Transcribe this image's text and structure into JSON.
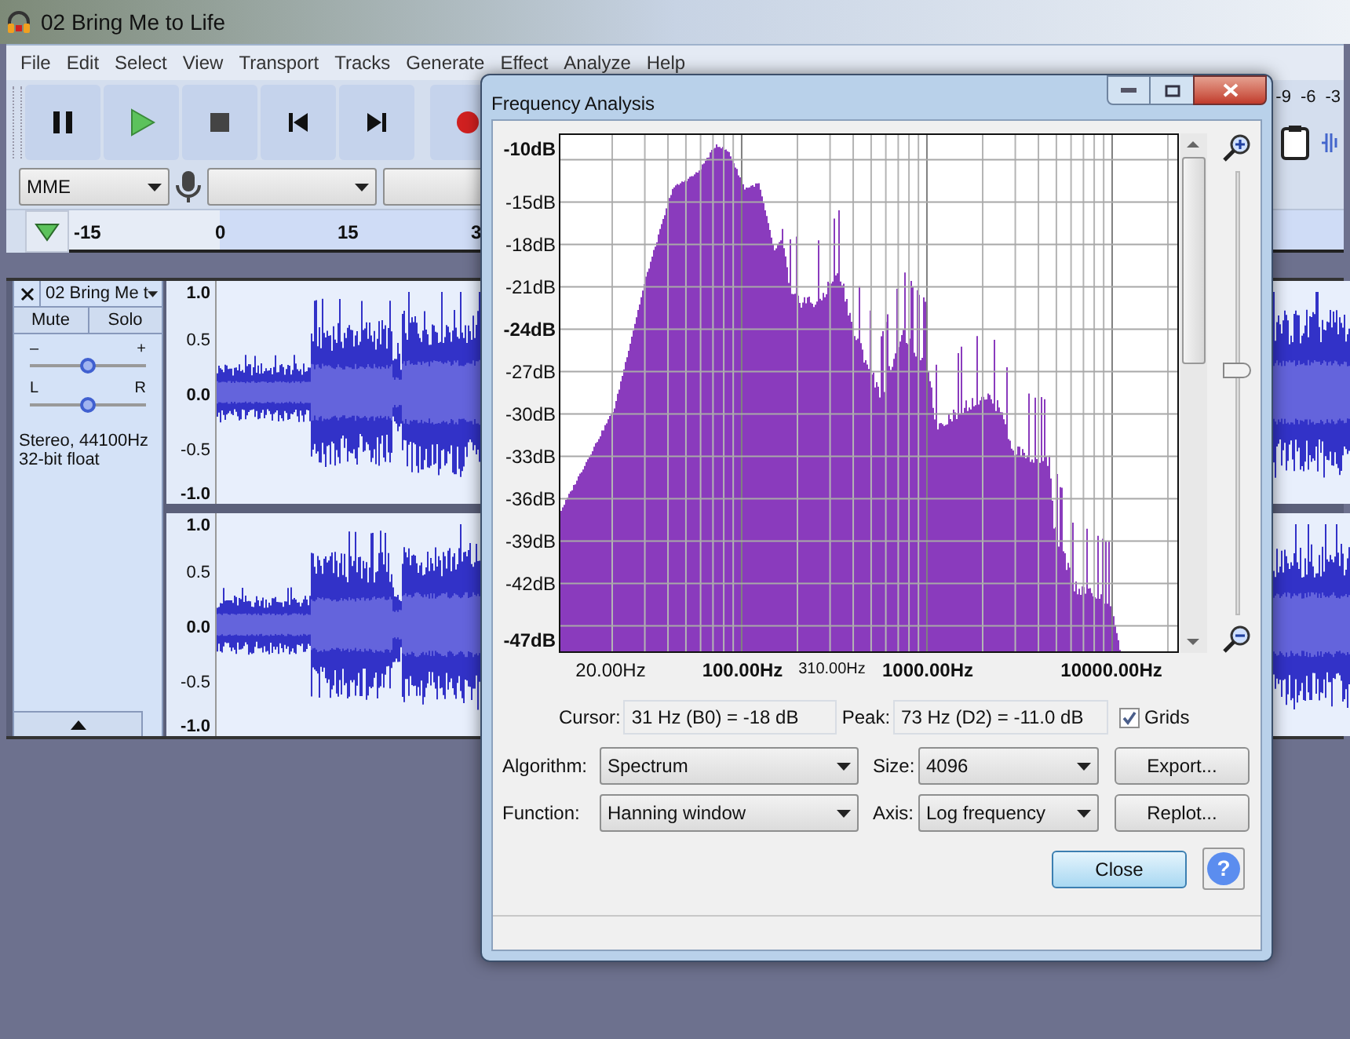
{
  "window": {
    "title": "02 Bring Me to Life"
  },
  "menu": [
    {
      "label": "File"
    },
    {
      "label": "Edit"
    },
    {
      "label": "Select"
    },
    {
      "label": "View"
    },
    {
      "label": "Transport"
    },
    {
      "label": "Tracks"
    },
    {
      "label": "Generate"
    },
    {
      "label": "Effect"
    },
    {
      "label": "Analyze"
    },
    {
      "label": "Help"
    }
  ],
  "meter": {
    "ticks": [
      "-9",
      "-6",
      "-3"
    ]
  },
  "device_bar": {
    "host": "MME"
  },
  "timeline": {
    "ticks": [
      "-15",
      "0",
      "15",
      "3"
    ]
  },
  "track": {
    "name": "02 Bring Me t",
    "mute": "Mute",
    "solo": "Solo",
    "gain": {
      "minus": "–",
      "plus": "+",
      "level": 0.5
    },
    "pan": {
      "left": "L",
      "right": "R",
      "level": 0.5
    },
    "info": [
      "Stereo, 44100Hz",
      "32-bit float"
    ],
    "channels": [
      {
        "scale": [
          "1.0",
          "0.5",
          "0.0",
          "-0.5",
          "-1.0"
        ]
      },
      {
        "scale": [
          "1.0",
          "0.5",
          "0.0",
          "-0.5",
          "-1.0"
        ]
      }
    ]
  },
  "dialog": {
    "title": "Frequency Analysis",
    "y_labels": [
      {
        "text": "-10dB",
        "kind": "major"
      },
      {
        "text": "-15dB",
        "kind": "minor"
      },
      {
        "text": "-18dB",
        "kind": "minor"
      },
      {
        "text": "-21dB",
        "kind": "minor"
      },
      {
        "text": "-24dB",
        "kind": "major"
      },
      {
        "text": "-27dB",
        "kind": "minor"
      },
      {
        "text": "-30dB",
        "kind": "minor"
      },
      {
        "text": "-33dB",
        "kind": "minor"
      },
      {
        "text": "-36dB",
        "kind": "minor"
      },
      {
        "text": "-39dB",
        "kind": "minor"
      },
      {
        "text": "-42dB",
        "kind": "minor"
      },
      {
        "text": "-47dB",
        "kind": "major"
      }
    ],
    "x_labels": [
      {
        "text": "20.00Hz",
        "kind": "minor"
      },
      {
        "text": "100.00Hz",
        "kind": "major"
      },
      {
        "text": "310.00Hz",
        "kind": "cursor"
      },
      {
        "text": "1000.00Hz",
        "kind": "major"
      },
      {
        "text": "10000.00Hz",
        "kind": "major"
      }
    ],
    "zoom": {
      "level": 0.55
    },
    "cursor": {
      "label": "Cursor:",
      "value": "31 Hz (B0) = -18 dB"
    },
    "peak": {
      "label": "Peak:",
      "value": "73 Hz (D2) = -11.0 dB"
    },
    "grids": {
      "label": "Grids",
      "checked": true
    },
    "algorithm": {
      "label": "Algorithm:",
      "value": "Spectrum"
    },
    "size": {
      "label": "Size:",
      "value": "4096"
    },
    "function": {
      "label": "Function:",
      "value": "Hanning window"
    },
    "axis": {
      "label": "Axis:",
      "value": "Log frequency"
    },
    "export": "Export...",
    "replot": "Replot...",
    "close": "Close",
    "help": "?"
  }
}
